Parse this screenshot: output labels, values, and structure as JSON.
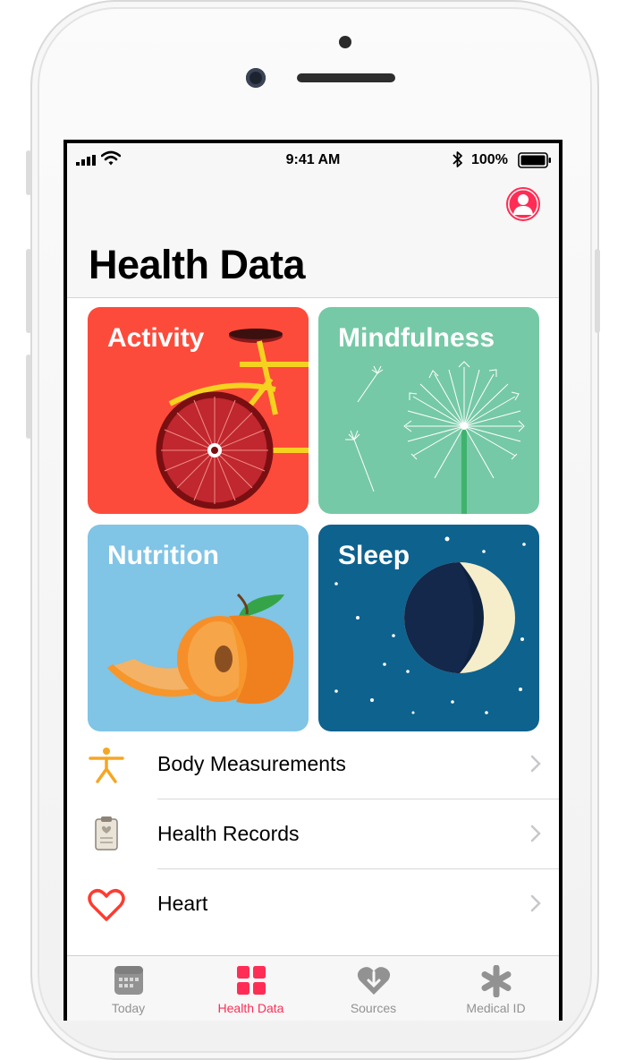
{
  "status_bar": {
    "time": "9:41 AM",
    "battery_percent": "100%"
  },
  "header": {
    "title": "Health Data"
  },
  "categories": [
    {
      "label": "Activity",
      "color": "#fd4b3b"
    },
    {
      "label": "Mindfulness",
      "color": "#76c9a6"
    },
    {
      "label": "Nutrition",
      "color": "#80c4e6"
    },
    {
      "label": "Sleep",
      "color": "#0e628e"
    }
  ],
  "list": [
    {
      "label": "Body Measurements",
      "icon": "person-figure-icon"
    },
    {
      "label": "Health Records",
      "icon": "clipboard-icon"
    },
    {
      "label": "Heart",
      "icon": "heart-icon"
    }
  ],
  "tabs": [
    {
      "label": "Today",
      "icon": "calendar-icon",
      "active": false
    },
    {
      "label": "Health Data",
      "icon": "grid-icon",
      "active": true
    },
    {
      "label": "Sources",
      "icon": "sources-heart-icon",
      "active": false
    },
    {
      "label": "Medical ID",
      "icon": "asterisk-icon",
      "active": false
    }
  ],
  "colors": {
    "accent": "#ff2d55",
    "inactive_tab": "#929292"
  }
}
